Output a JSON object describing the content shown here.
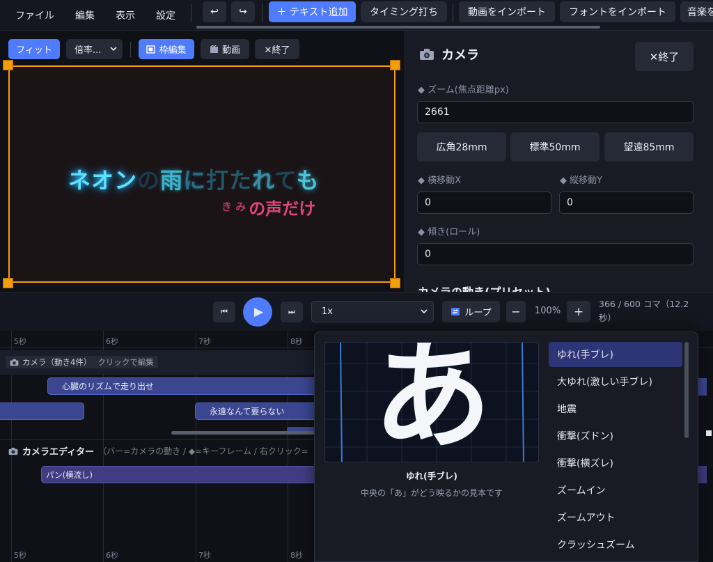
{
  "menu": [
    "ファイル",
    "編集",
    "表示",
    "設定"
  ],
  "toolbar": {
    "undo_glyph": "↩",
    "redo_glyph": "↪",
    "add_text": "＋ テキスト追加",
    "timing": "タイミング打ち",
    "import_video": "動画をインポート",
    "import_font": "フォントをインポート",
    "import_music": "音楽を"
  },
  "preview": {
    "fit": "フィット",
    "zoom_select": "倍率...",
    "frame_edit": "枠編集",
    "video": "動画",
    "close": "✕終了",
    "lyric_main": [
      "ネオン",
      "の",
      "雨",
      "に",
      "打た",
      "れ",
      "て",
      "も"
    ],
    "lyric_ruby": "き み",
    "lyric_sub": "の声だけ"
  },
  "camera_panel": {
    "title": "カメラ",
    "close": "✕終了",
    "zoom_label": "ズーム(焦点距離px)",
    "zoom_value": "2661",
    "lens_wide": "広角28mm",
    "lens_std": "標準50mm",
    "lens_tele": "望遠85mm",
    "pan_x_label": "横移動X",
    "pan_x_value": "0",
    "pan_y_label": "縦移動Y",
    "pan_y_value": "0",
    "roll_label": "傾き(ロール)",
    "roll_value": "0",
    "preset_heading": "カメラの動き(プリセット)"
  },
  "transport": {
    "prev_glyph": "⏮",
    "play_glyph": "▶",
    "next_glyph": "⏭",
    "speed": "1x",
    "loop": "ループ",
    "minus": "−",
    "zoom": "100%",
    "plus": "+",
    "frame_info": "366 / 600 コマ（12.2秒）"
  },
  "timeline": {
    "ruler": [
      "5秒",
      "6秒",
      "7秒",
      "8秒"
    ],
    "camera_track": "カメラ（動き4件）",
    "camera_hint": "クリックで編集",
    "clip1": "心臓のリズムで走り出せ",
    "clip2": "永遠なんて要らない",
    "editor_title": "カメラエディター",
    "editor_hint": "（バー=カメラの動き / ◆=キーフレーム / 右クリック=",
    "pan_clip": "パン(横流し)"
  },
  "preset_popup": {
    "preview_char": "あ",
    "preview_name": "ゆれ(手ブレ)",
    "preview_caption": "中央の「あ」がどう映るかの見本です",
    "items": [
      "ゆれ(手ブレ)",
      "大ゆれ(激しい手ブレ)",
      "地震",
      "衝撃(ズドン)",
      "衝撃(横ズレ)",
      "ズームイン",
      "ズームアウト",
      "クラッシュズーム"
    ],
    "selected_index": 0
  },
  "colors": {
    "accent": "#4f7cff",
    "frame": "#f59e0b",
    "neon": "#5ee0ff",
    "lyric_pink": "#e0457a"
  }
}
